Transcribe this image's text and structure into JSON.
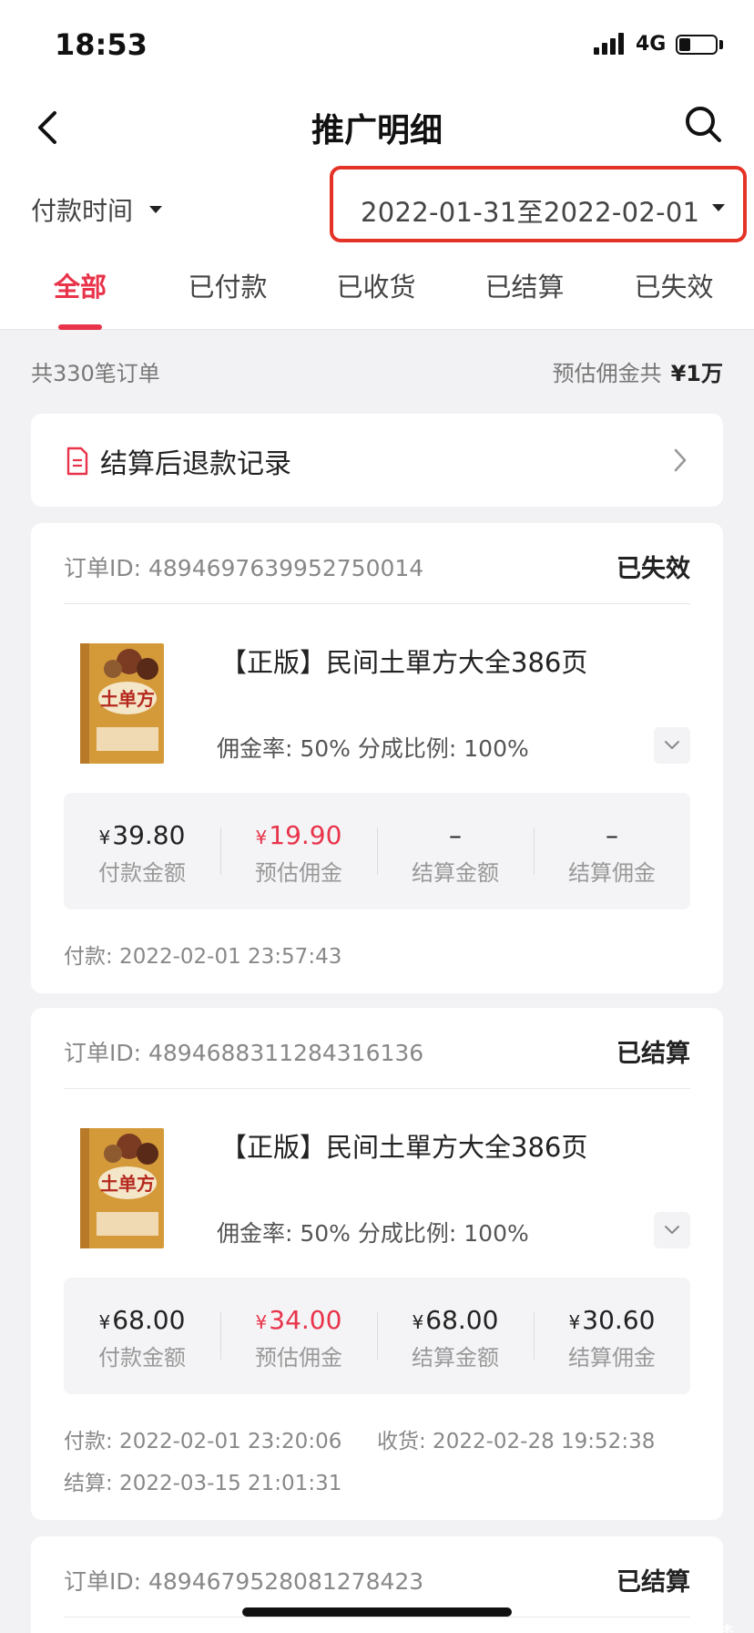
{
  "status_bar": {
    "time": "18:53",
    "network": "4G"
  },
  "header": {
    "title": "推广明细"
  },
  "filter": {
    "label": "付款时间",
    "date_range": "2022-01-31至2022-02-01"
  },
  "tabs": [
    {
      "label": "全部",
      "active": true
    },
    {
      "label": "已付款"
    },
    {
      "label": "已收货"
    },
    {
      "label": "已结算"
    },
    {
      "label": "已失效"
    }
  ],
  "summary": {
    "count": "共330笔订单",
    "commission_label": "预估佣金共",
    "commission_value": "¥1万"
  },
  "refund_record": {
    "label": "结算后退款记录"
  },
  "orders": [
    {
      "id": "订单ID: 4894697639952750014",
      "status": "已失效",
      "product_title": "【正版】民间土單方大全386页",
      "commission_rate": "佣金率: 50%   分成比例: 100%",
      "book_cover_text": "土单方",
      "amounts": [
        {
          "value": "39.80",
          "label": "付款金额"
        },
        {
          "value": "19.90",
          "label": "预估佣金"
        },
        {
          "value": "–",
          "label": "结算金额"
        },
        {
          "value": "–",
          "label": "结算佣金"
        }
      ],
      "payment_time": "付款: 2022-02-01 23:57:43"
    },
    {
      "id": "订单ID: 4894688311284316136",
      "status": "已结算",
      "product_title": "【正版】民间土單方大全386页",
      "commission_rate": "佣金率: 50%   分成比例: 100%",
      "book_cover_text": "土单方",
      "amounts": [
        {
          "value": "68.00",
          "label": "付款金额"
        },
        {
          "value": "34.00",
          "label": "预估佣金"
        },
        {
          "value": "68.00",
          "label": "结算金额"
        },
        {
          "value": "30.60",
          "label": "结算佣金"
        }
      ],
      "payment_time": "付款: 2022-02-01 23:20:06",
      "receive_time": "收货: 2022-02-28 19:52:38",
      "settle_time": "结算: 2022-03-15 21:01:31"
    },
    {
      "id": "订单ID: 4894679528081278423",
      "status": "已结算"
    }
  ],
  "currency_symbol": "¥",
  "watermark": "知乎 @云梦",
  "colors": {
    "accent": "#e8334a",
    "highlight_border": "#e53226",
    "background": "#f2f2f4"
  }
}
